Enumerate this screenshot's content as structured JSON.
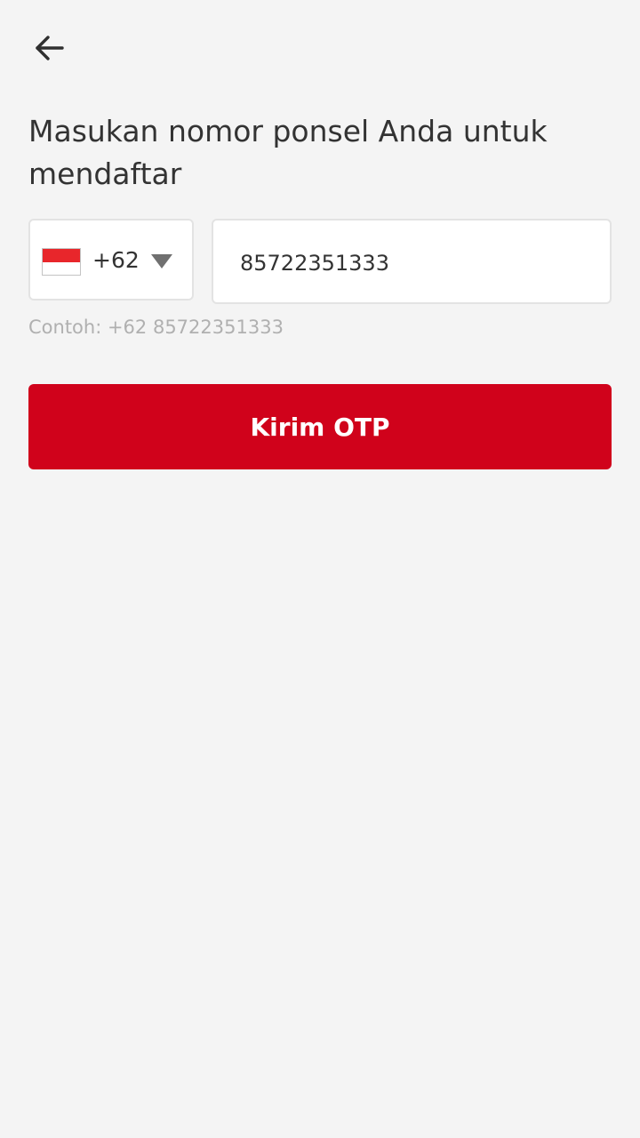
{
  "header": {
    "back_icon": "arrow-left-icon"
  },
  "title": "Masukan nomor ponsel Anda untuk mendaftar",
  "country_picker": {
    "flag_icon": "indonesia-flag-icon",
    "code": "+62",
    "caret_icon": "caret-down-icon"
  },
  "phone": {
    "value": "85722351333"
  },
  "hint": "Contoh: +62 85722351333",
  "submit_label": "Kirim OTP",
  "colors": {
    "accent": "#d0021b",
    "background": "#f4f4f4",
    "flag_red": "#e8262b"
  }
}
